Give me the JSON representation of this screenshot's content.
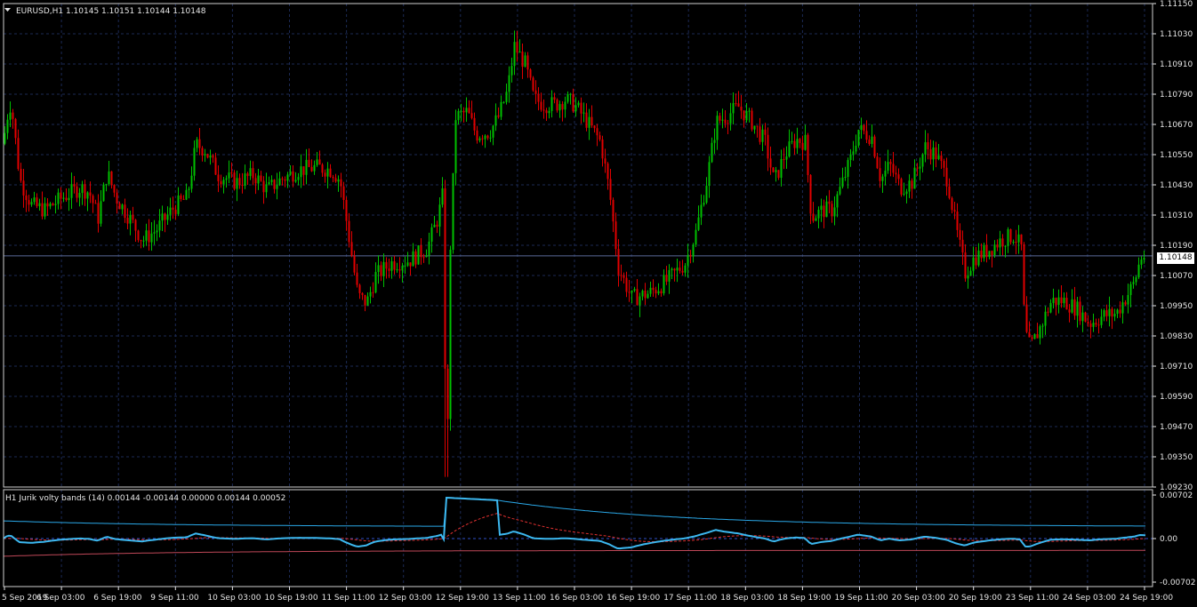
{
  "main_panel": {
    "header": "EURUSD,H1  1.10145 1.10151 1.10144 1.10148",
    "menu_icon": "triangle-down-icon",
    "price_labels": [
      "1.11150",
      "1.11030",
      "1.10910",
      "1.10790",
      "1.10670",
      "1.10550",
      "1.10430",
      "1.10310",
      "1.10190",
      "1.10070",
      "1.09950",
      "1.09830",
      "1.09710",
      "1.09590",
      "1.09470",
      "1.09350",
      "1.09230"
    ],
    "current_price": "1.10148",
    "current_price_value": 1.10148
  },
  "indicator_panel": {
    "header": "H1 Jurik volty bands (14) 0.00144 -0.00144 0.00000 0.00144 0.00052",
    "scale_labels": [
      "0.00702",
      "0.00",
      "-0.00702"
    ]
  },
  "time_axis": {
    "labels": [
      "5 Sep 2019",
      "6 Sep 03:00",
      "6 Sep 19:00",
      "9 Sep 11:00",
      "10 Sep 03:00",
      "10 Sep 19:00",
      "11 Sep 11:00",
      "12 Sep 03:00",
      "12 Sep 19:00",
      "13 Sep 11:00",
      "16 Sep 03:00",
      "16 Sep 19:00",
      "17 Sep 11:00",
      "18 Sep 03:00",
      "18 Sep 19:00",
      "19 Sep 11:00",
      "20 Sep 03:00",
      "20 Sep 19:00",
      "23 Sep 11:00",
      "24 Sep 03:00",
      "24 Sep 19:00"
    ]
  },
  "colors": {
    "background": "#000000",
    "grid": "#1c2a55",
    "bull_candle": "#00c000",
    "bear_candle": "#e00000",
    "band_upper": "#2aa8e8",
    "band_lower": "#c04858",
    "zero_line": "#3050c8",
    "axis_text": "#e6e6e6"
  },
  "chart_data": {
    "type": "candlestick",
    "symbol": "EURUSD",
    "timeframe": "H1",
    "ylim": [
      1.0923,
      1.1115
    ],
    "price_path": [
      [
        0,
        1.1042
      ],
      [
        6,
        1.1068
      ],
      [
        12,
        1.1076
      ],
      [
        22,
        1.1045
      ],
      [
        35,
        1.1035
      ],
      [
        50,
        1.1033
      ],
      [
        70,
        1.1038
      ],
      [
        90,
        1.1042
      ],
      [
        100,
        1.104
      ],
      [
        110,
        1.103
      ],
      [
        120,
        1.1048
      ],
      [
        130,
        1.1038
      ],
      [
        145,
        1.103
      ],
      [
        160,
        1.1021
      ],
      [
        175,
        1.1025
      ],
      [
        195,
        1.1034
      ],
      [
        210,
        1.1038
      ],
      [
        220,
        1.1059
      ],
      [
        230,
        1.1057
      ],
      [
        245,
        1.1047
      ],
      [
        265,
        1.1044
      ],
      [
        285,
        1.1047
      ],
      [
        300,
        1.1041
      ],
      [
        315,
        1.1045
      ],
      [
        335,
        1.1049
      ],
      [
        355,
        1.105
      ],
      [
        372,
        1.1049
      ],
      [
        382,
        1.1045
      ],
      [
        392,
        1.1022
      ],
      [
        402,
        1.0999
      ],
      [
        412,
        1.0996
      ],
      [
        422,
        1.1007
      ],
      [
        440,
        1.1012
      ],
      [
        460,
        1.1013
      ],
      [
        480,
        1.1018
      ],
      [
        492,
        1.103
      ],
      [
        498,
        1.104
      ],
      [
        502,
        1.0945
      ],
      [
        506,
        1.1019
      ],
      [
        512,
        1.107
      ],
      [
        525,
        1.1072
      ],
      [
        535,
        1.1063
      ],
      [
        550,
        1.1064
      ],
      [
        560,
        1.107
      ],
      [
        570,
        1.108
      ],
      [
        578,
        1.1098
      ],
      [
        590,
        1.1091
      ],
      [
        600,
        1.1077
      ],
      [
        612,
        1.1075
      ],
      [
        625,
        1.1075
      ],
      [
        635,
        1.1077
      ],
      [
        645,
        1.1075
      ],
      [
        660,
        1.1068
      ],
      [
        675,
        1.106
      ],
      [
        685,
        1.104
      ],
      [
        695,
        1.101
      ],
      [
        710,
        1.0998
      ],
      [
        730,
        1.1
      ],
      [
        750,
        1.1005
      ],
      [
        770,
        1.1012
      ],
      [
        782,
        1.1024
      ],
      [
        795,
        1.1046
      ],
      [
        805,
        1.1068
      ],
      [
        815,
        1.107
      ],
      [
        830,
        1.1074
      ],
      [
        845,
        1.1068
      ],
      [
        860,
        1.106
      ],
      [
        870,
        1.1044
      ],
      [
        882,
        1.1055
      ],
      [
        895,
        1.1061
      ],
      [
        905,
        1.106
      ],
      [
        912,
        1.103
      ],
      [
        925,
        1.1033
      ],
      [
        935,
        1.1033
      ],
      [
        945,
        1.1042
      ],
      [
        955,
        1.1052
      ],
      [
        965,
        1.1065
      ],
      [
        980,
        1.1062
      ],
      [
        990,
        1.1045
      ],
      [
        1000,
        1.1051
      ],
      [
        1012,
        1.1042
      ],
      [
        1025,
        1.1044
      ],
      [
        1040,
        1.1058
      ],
      [
        1052,
        1.1055
      ],
      [
        1065,
        1.1045
      ],
      [
        1075,
        1.1025
      ],
      [
        1085,
        1.1008
      ],
      [
        1095,
        1.1014
      ],
      [
        1110,
        1.1017
      ],
      [
        1125,
        1.1021
      ],
      [
        1140,
        1.1023
      ],
      [
        1148,
        1.1018
      ],
      [
        1152,
        1.0985
      ],
      [
        1158,
        1.0978
      ],
      [
        1170,
        1.0987
      ],
      [
        1182,
        1.0997
      ],
      [
        1195,
        1.0997
      ],
      [
        1210,
        1.0994
      ],
      [
        1225,
        1.0988
      ],
      [
        1240,
        1.0991
      ],
      [
        1255,
        1.0992
      ],
      [
        1265,
        1.0998
      ],
      [
        1275,
        1.1004
      ],
      [
        1282,
        1.1014
      ],
      [
        1287,
        1.1015
      ]
    ],
    "oscillator": {
      "name": "Jurik volty bands (14)",
      "ylim": [
        -0.00702,
        0.00702
      ],
      "values_printed": [
        0.00144,
        -0.00144,
        0.0,
        0.00144,
        0.00052
      ],
      "series": [
        "upper band",
        "lower band",
        "middle",
        "signal"
      ]
    }
  }
}
